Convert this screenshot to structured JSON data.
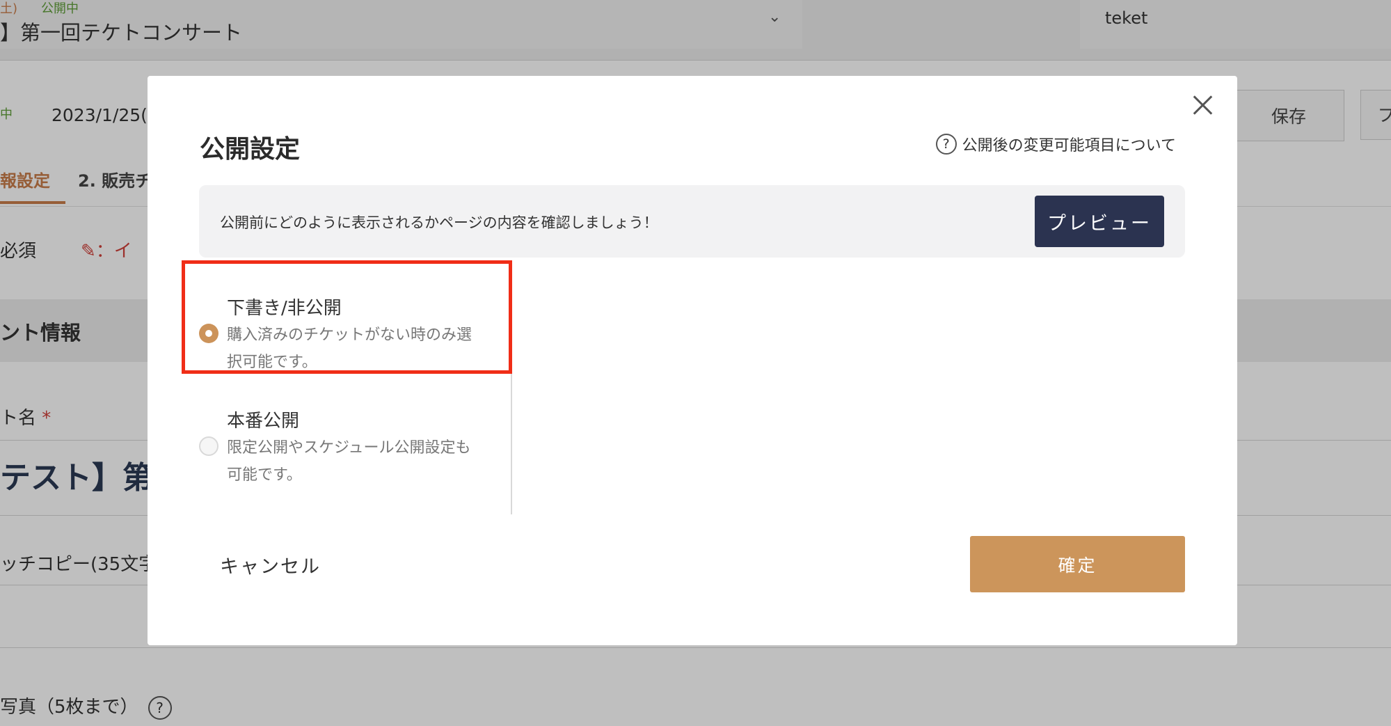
{
  "background": {
    "event_status_date": "土)",
    "event_status": "公開中",
    "event_title": "】第一回テケトコンサート",
    "organizer": "teket",
    "status_dot": "中",
    "publish_date": "2023/1/25(",
    "save_label": "保存",
    "partial_button": "プ",
    "tab_active": "報設定",
    "tab_2": "2. 販売チ",
    "required_legend": "必須",
    "required_icon_text": "：イ",
    "section_title": "ント情報",
    "field_name_label": "ト名",
    "field_name_asterisk": "*",
    "field_name_value": "テスト】第",
    "catch_label": "ッチコピー(35文字",
    "photo_label": "写真（5枚まで）",
    "photo_help": "?"
  },
  "modal": {
    "title": "公開設定",
    "help_icon": "?",
    "help_link": "公開後の変更可能項目について",
    "preview_text": "公開前にどのように表示されるかページの内容を確認しましょう！",
    "preview_button": "プレビュー",
    "options": [
      {
        "title": "下書き/非公開",
        "description": "購入済みのチケットがない時のみ選択可能です。",
        "selected": true
      },
      {
        "title": "本番公開",
        "description": "限定公開やスケジュール公開設定も可能です。",
        "selected": false
      }
    ],
    "cancel_label": "キャンセル",
    "confirm_label": "確定"
  },
  "colors": {
    "accent": "#cc955b",
    "preview_button": "#2b3350",
    "highlight": "#f02d17",
    "status_green": "#5f9e39"
  },
  "icons": {
    "close": "close-icon",
    "help": "question-circle-icon",
    "chevron": "chevron-down-icon"
  }
}
